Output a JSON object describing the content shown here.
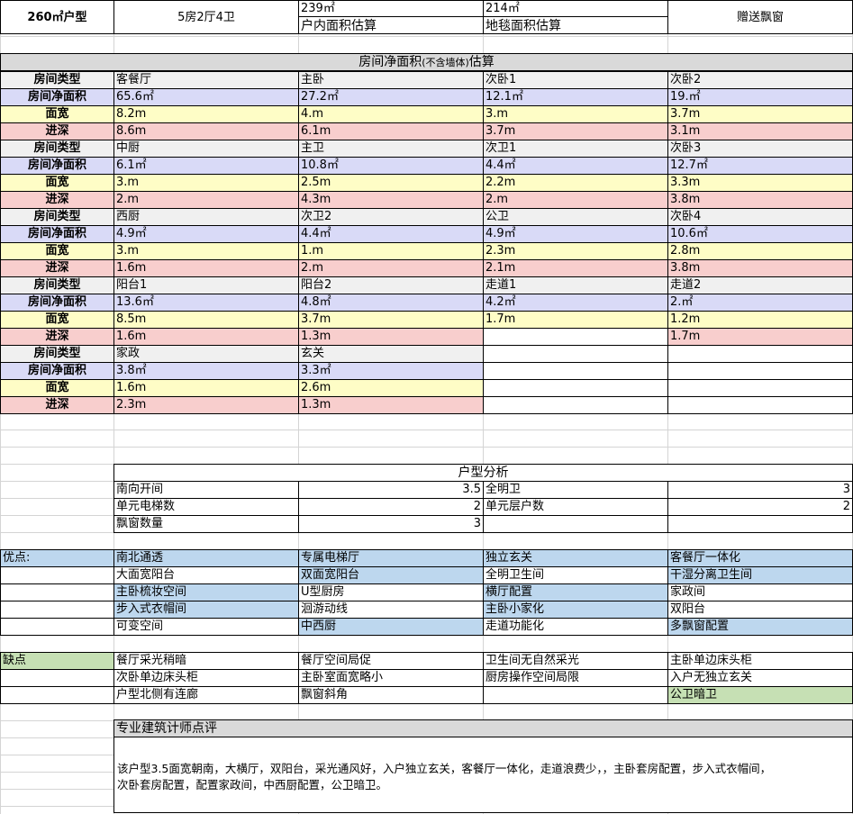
{
  "header": {
    "layout_title": "260㎡户型",
    "rooms": "5房2厅4卫",
    "gross_area": "239㎡",
    "gross_area_label": "户内面积估算",
    "carpet_area": "214㎡",
    "carpet_area_label": "地毯面积估算",
    "bay_window": "赠送飘窗"
  },
  "net_area": {
    "section_title_pre": "房间净面积",
    "section_title_small": "(不含墙体)",
    "section_title_post": "估算",
    "labels": {
      "type": "房间类型",
      "area": "房间净面积",
      "width": "面宽",
      "depth": "进深"
    },
    "groups": [
      [
        {
          "name": "客餐厅",
          "area": "65.6㎡",
          "width": "8.2m",
          "depth": "8.6m"
        },
        {
          "name": "主卧",
          "area": "27.2㎡",
          "width": "4.m",
          "depth": "6.1m"
        },
        {
          "name": "次卧1",
          "area": "12.1㎡",
          "width": "3.m",
          "depth": "3.7m"
        },
        {
          "name": "次卧2",
          "area": "19.㎡",
          "width": "3.7m",
          "depth": "3.1m"
        }
      ],
      [
        {
          "name": "中厨",
          "area": "6.1㎡",
          "width": "3.m",
          "depth": "2.m"
        },
        {
          "name": "主卫",
          "area": "10.8㎡",
          "width": "2.5m",
          "depth": "4.3m"
        },
        {
          "name": "次卫1",
          "area": "4.4㎡",
          "width": "2.2m",
          "depth": "2.m"
        },
        {
          "name": "次卧3",
          "area": "12.7㎡",
          "width": "3.3m",
          "depth": "3.8m"
        }
      ],
      [
        {
          "name": "西厨",
          "area": "4.9㎡",
          "width": "3.m",
          "depth": "1.6m"
        },
        {
          "name": "次卫2",
          "area": "4.4㎡",
          "width": "1.m",
          "depth": "2.m"
        },
        {
          "name": "公卫",
          "area": "4.9㎡",
          "width": "2.3m",
          "depth": "2.1m"
        },
        {
          "name": "次卧4",
          "area": "10.6㎡",
          "width": "2.8m",
          "depth": "3.8m"
        }
      ],
      [
        {
          "name": "阳台1",
          "area": "13.6㎡",
          "width": "8.5m",
          "depth": "1.6m"
        },
        {
          "name": "阳台2",
          "area": "4.8㎡",
          "width": "3.7m",
          "depth": "1.3m"
        },
        {
          "name": "走道1",
          "area": "4.2㎡",
          "width": "1.7m",
          "depth": ""
        },
        {
          "name": "走道2",
          "area": "2.㎡",
          "width": "1.2m",
          "depth": "1.7m"
        }
      ],
      [
        {
          "name": "家政",
          "area": "3.8㎡",
          "width": "1.6m",
          "depth": "2.3m"
        },
        {
          "name": "玄关",
          "area": "3.3㎡",
          "width": "2.6m",
          "depth": "1.3m"
        },
        {
          "name": "",
          "area": "",
          "width": "",
          "depth": ""
        },
        {
          "name": "",
          "area": "",
          "width": "",
          "depth": ""
        }
      ]
    ]
  },
  "analysis": {
    "title": "户型分析",
    "rows": [
      {
        "k1": "南向开间",
        "v1": "3.5",
        "k2": "全明卫",
        "v2": "3"
      },
      {
        "k1": "单元电梯数",
        "v1": "2",
        "k2": "单元层户数",
        "v2": "2"
      },
      {
        "k1": "飘窗数量",
        "v1": "3",
        "k2": "",
        "v2": ""
      }
    ]
  },
  "pros": {
    "label": "优点:",
    "rows": [
      [
        "南北通透",
        "专属电梯厅",
        "独立玄关",
        "客餐厅一体化"
      ],
      [
        "大面宽阳台",
        "双面宽阳台",
        "全明卫生间",
        "干湿分离卫生间"
      ],
      [
        "主卧梳妆空间",
        "U型厨房",
        "横厅配置",
        "家政间"
      ],
      [
        "步入式衣帽间",
        "洄游动线",
        "主卧小家化",
        "双阳台"
      ],
      [
        "可变空间",
        "中西厨",
        "走道功能化",
        "多飘窗配置"
      ]
    ]
  },
  "cons": {
    "label": "缺点",
    "rows": [
      [
        "餐厅采光稍暗",
        "餐厅空间局促",
        "卫生间无自然采光",
        "主卧单边床头柜"
      ],
      [
        "次卧单边床头柜",
        "主卧室面宽略小",
        "厨房操作空间局限",
        "入户无独立玄关"
      ],
      [
        "户型北侧有连廊",
        "飘窗斜角",
        "",
        "公卫暗卫"
      ]
    ]
  },
  "review": {
    "title": "专业建筑计师点评",
    "line1": "该户型3.5面宽朝南，大横厅，双阳台，采光通风好，入户独立玄关，客餐厅一体化，走道浪费少，，主卧套房配置，步入式衣帽间，",
    "line2": "次卧套房配置，配置家政间，中西厨配置，公卫暗卫。"
  },
  "colors": {
    "area_row": "#d9daf7",
    "width_row": "#fefdc6",
    "depth_row": "#f8cecd",
    "type_row": "#f0f0f0",
    "pros": "#bdd7ee",
    "cons": "#c6e0b4"
  }
}
